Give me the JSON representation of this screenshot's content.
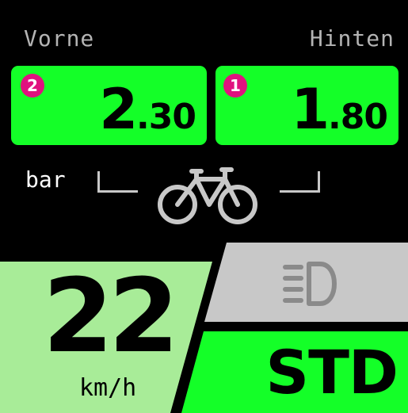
{
  "tyres": {
    "front": {
      "label": "Vorne",
      "sensor_number": "2",
      "pressure_integer": "2",
      "pressure_decimal": ".30"
    },
    "rear": {
      "label": "Hinten",
      "sensor_number": "1",
      "pressure_integer": "1",
      "pressure_decimal": ".80"
    },
    "unit": "bar"
  },
  "speed": {
    "value": "22",
    "unit": "km/h"
  },
  "light": {
    "icon": "headlight-icon"
  },
  "mode": {
    "label": "STD"
  },
  "colors": {
    "background": "#000000",
    "pressure_ok": "#14ff28",
    "sensor_badge": "#e0127f",
    "speed_panel": "#a8ec98",
    "light_button": "#c8c8c8",
    "mode_button": "#14ff28"
  }
}
